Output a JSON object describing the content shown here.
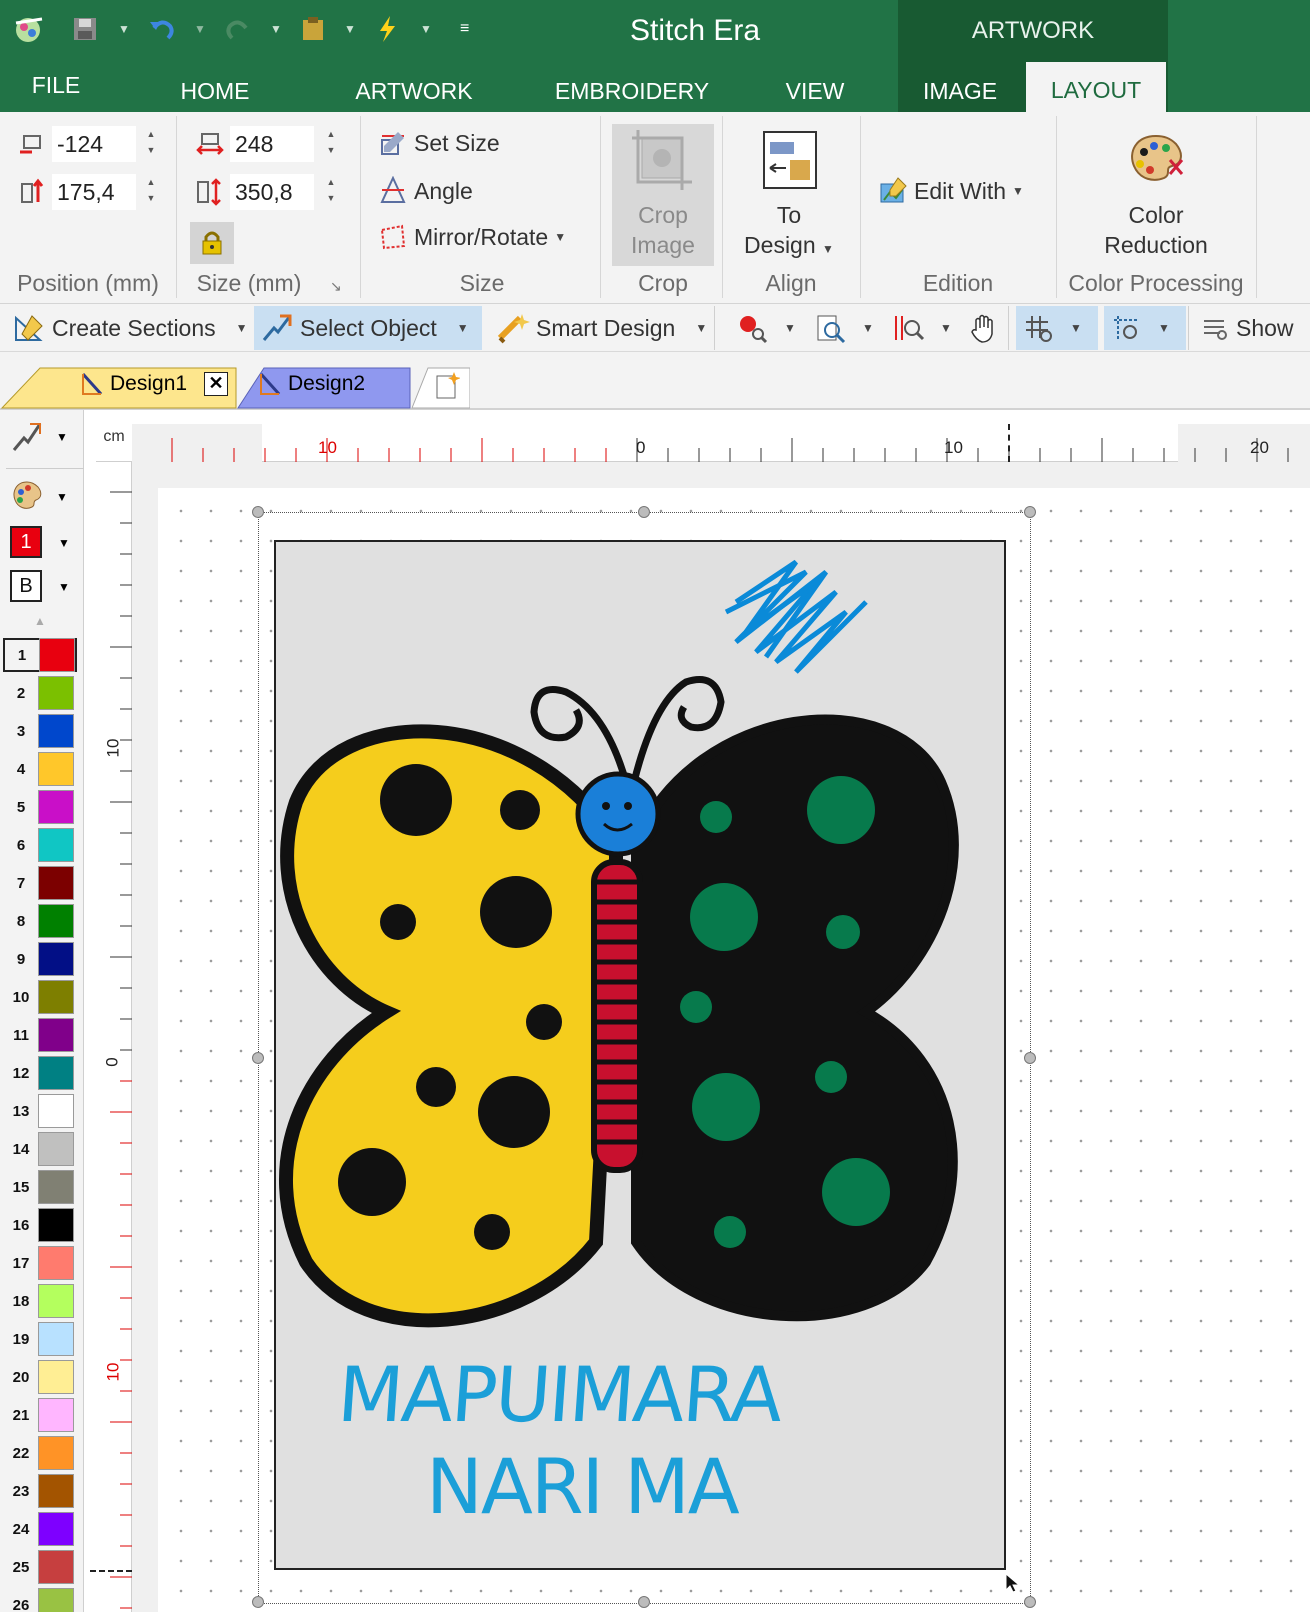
{
  "window": {
    "title": "Stitch Era",
    "context_header": "ARTWORK"
  },
  "tabs": [
    {
      "label": "FILE"
    },
    {
      "label": "HOME"
    },
    {
      "label": "ARTWORK"
    },
    {
      "label": "EMBROIDERY"
    },
    {
      "label": "VIEW"
    },
    {
      "label": "IMAGE"
    },
    {
      "label": "LAYOUT",
      "active": true
    }
  ],
  "ribbon": {
    "position": {
      "x": "-124",
      "y": "175,4",
      "label": "Position (mm)"
    },
    "size_fields": {
      "width": "248",
      "height": "350,8",
      "label": "Size (mm)"
    },
    "size_group": {
      "set_size": "Set Size",
      "angle": "Angle",
      "mirror_rotate": "Mirror/Rotate",
      "label": "Size"
    },
    "crop": {
      "button": "Crop\nImage",
      "line1": "Crop",
      "line2": "Image",
      "label": "Crop"
    },
    "align": {
      "line1": "To",
      "line2": "Design",
      "label": "Align"
    },
    "edition": {
      "edit_with": "Edit With",
      "label": "Edition"
    },
    "color_processing": {
      "line1": "Color",
      "line2": "Reduction",
      "label": "Color Processing"
    }
  },
  "toolbar": {
    "create_sections": "Create Sections",
    "select_object": "Select Object",
    "smart_design": "Smart Design",
    "show": "Show"
  },
  "doc_tabs": [
    {
      "label": "Design1",
      "active": true
    },
    {
      "label": "Design2"
    }
  ],
  "left_tools": {
    "color_number": "1",
    "background_label": "B"
  },
  "palette": [
    {
      "n": "1",
      "color": "#e8000f"
    },
    {
      "n": "2",
      "color": "#7bc000"
    },
    {
      "n": "3",
      "color": "#0047cc"
    },
    {
      "n": "4",
      "color": "#ffc72a"
    },
    {
      "n": "5",
      "color": "#c90fc8"
    },
    {
      "n": "6",
      "color": "#10c6c4"
    },
    {
      "n": "7",
      "color": "#7c0000"
    },
    {
      "n": "8",
      "color": "#008000"
    },
    {
      "n": "9",
      "color": "#020f86"
    },
    {
      "n": "10",
      "color": "#7e7f00"
    },
    {
      "n": "11",
      "color": "#80008a"
    },
    {
      "n": "12",
      "color": "#008083"
    },
    {
      "n": "13",
      "color": "#ffffff"
    },
    {
      "n": "14",
      "color": "#c0c0bf"
    },
    {
      "n": "15",
      "color": "#808073"
    },
    {
      "n": "16",
      "color": "#000000"
    },
    {
      "n": "17",
      "color": "#ff7b6e"
    },
    {
      "n": "18",
      "color": "#b4ff5e"
    },
    {
      "n": "19",
      "color": "#b8e1ff"
    },
    {
      "n": "20",
      "color": "#ffee94"
    },
    {
      "n": "21",
      "color": "#ffb6ff"
    },
    {
      "n": "22",
      "color": "#ff9326"
    },
    {
      "n": "23",
      "color": "#a35400"
    },
    {
      "n": "24",
      "color": "#7e00ff"
    },
    {
      "n": "25",
      "color": "#c63f3f"
    },
    {
      "n": "26",
      "color": "#99c243"
    }
  ],
  "ruler": {
    "unit": "cm",
    "h_labels": [
      {
        "t": "10",
        "red": true
      },
      {
        "t": "0"
      },
      {
        "t": "10"
      },
      {
        "t": "20"
      }
    ],
    "v_labels": [
      {
        "t": "10"
      },
      {
        "t": "0"
      },
      {
        "t": "10",
        "red": true
      }
    ]
  },
  "artwork": {
    "handwriting_line1": "MAPUIMARA",
    "handwriting_line2": "NARI MA"
  },
  "colors": {
    "ribbon_green": "#217346",
    "context_green": "#185a32",
    "highlight": "#c9dff2"
  }
}
